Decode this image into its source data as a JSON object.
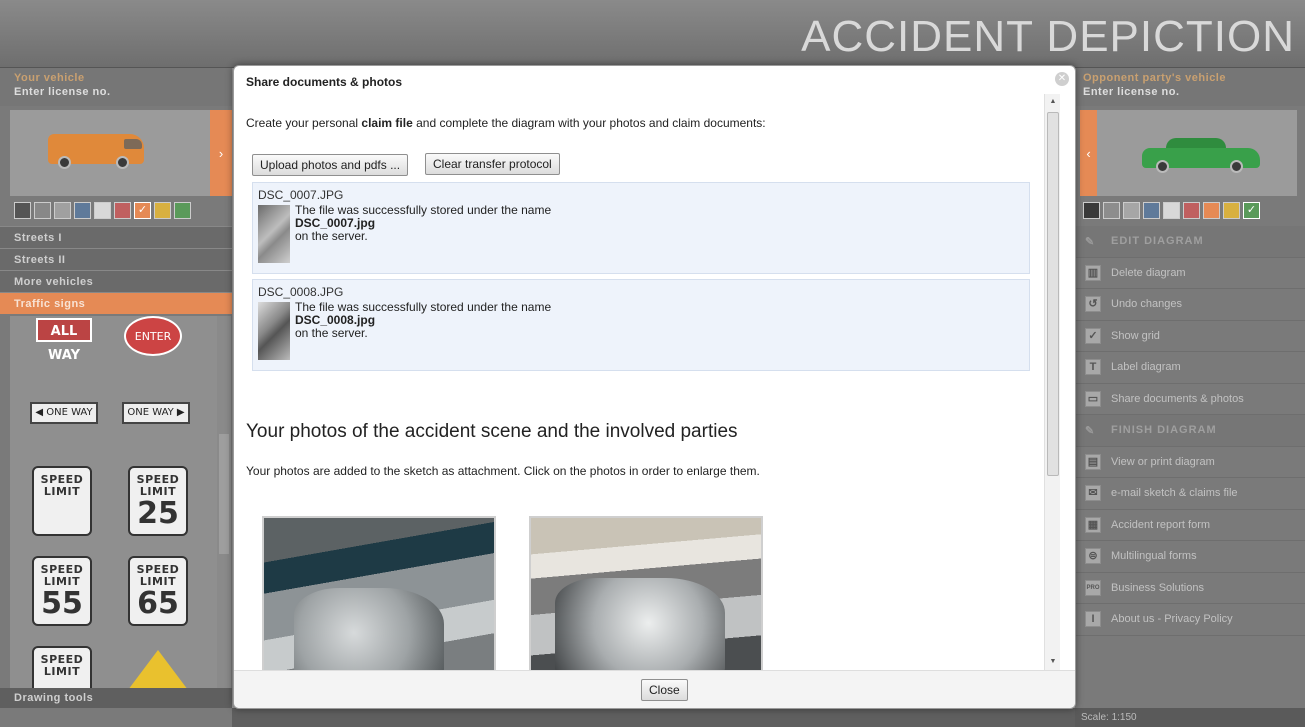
{
  "app": {
    "title": "ACCIDENT  DEPICTION"
  },
  "left_panel": {
    "vehicle_title": "Your vehicle",
    "license_placeholder": "Enter license no.",
    "arrow": "›",
    "colors": [
      "#555555",
      "#888888",
      "#a0a0a0",
      "#5f7a9a",
      "#d8d8d8",
      "#c06060",
      "#e58a55",
      "#d8b040",
      "#5a9a5a"
    ],
    "selected_color_index": 6,
    "menu": [
      {
        "label": "Streets I",
        "active": false
      },
      {
        "label": "Streets II",
        "active": false
      },
      {
        "label": "More vehicles",
        "active": false
      },
      {
        "label": "Traffic signs",
        "active": true
      }
    ],
    "signs": {
      "all_way": "ALL WAY",
      "enter": "ENTER",
      "one_way_left": "◀ ONE WAY",
      "one_way_right": "ONE WAY ▶",
      "speed_label": "SPEED LIMIT",
      "speed_values": [
        "",
        "25",
        "55",
        "65",
        ""
      ]
    },
    "drawing_tools": "Drawing tools"
  },
  "right_panel": {
    "vehicle_title": "Opponent party's vehicle",
    "license_placeholder": "Enter license no.",
    "arrow": "‹",
    "colors": [
      "#3a3a3a",
      "#8d8d8d",
      "#a6a6a6",
      "#5f7a9a",
      "#d8d8d8",
      "#c06060",
      "#e58a55",
      "#d8b040",
      "#5a9a5a"
    ],
    "selected_color_index": 8,
    "edit_section": "EDIT DIAGRAM",
    "edit_items": [
      {
        "label": "Delete diagram",
        "icon": "trash-icon",
        "glyph": "▥"
      },
      {
        "label": "Undo changes",
        "icon": "undo-icon",
        "glyph": "↺"
      },
      {
        "label": "Show grid",
        "icon": "checkbox-icon",
        "glyph": "✓"
      },
      {
        "label": "Label diagram",
        "icon": "text-icon",
        "glyph": "T"
      },
      {
        "label": "Share documents & photos",
        "icon": "folder-icon",
        "glyph": "▭"
      }
    ],
    "finish_section": "FINISH DIAGRAM",
    "finish_items": [
      {
        "label": "View or print diagram",
        "icon": "document-icon",
        "glyph": "▤"
      },
      {
        "label": "e-mail sketch & claims file",
        "icon": "mail-icon",
        "glyph": "✉"
      },
      {
        "label": "Accident report form",
        "icon": "form-icon",
        "glyph": "▦"
      },
      {
        "label": "Multilingual forms",
        "icon": "globe-icon",
        "glyph": "⊜"
      },
      {
        "label": "Business Solutions",
        "icon": "pro-icon",
        "glyph": "PRO"
      },
      {
        "label": "About us - Privacy Policy",
        "icon": "info-icon",
        "glyph": "I"
      }
    ],
    "scale": "Scale: 1:150"
  },
  "dialog": {
    "title": "Share documents & photos",
    "intro_before": "Create your personal ",
    "intro_bold": "claim file",
    "intro_after": " and complete the diagram with your photos and claim documents:",
    "upload_button": "Upload photos and pdfs ...",
    "clear_button": "Clear transfer protocol",
    "files": [
      {
        "name": "DSC_0007.JPG",
        "msg_line1": "The file was successfully stored under the name",
        "stored_name": "DSC_0007.jpg",
        "msg_line2": "on the server."
      },
      {
        "name": "DSC_0008.JPG",
        "msg_line1": "The file was successfully stored under the name",
        "stored_name": "DSC_0008.jpg",
        "msg_line2": "on the server."
      }
    ],
    "photos_heading": "Your photos of the accident scene and the involved parties",
    "photos_text": "Your photos are added to the sketch as attachment. Click on the photos in order to enlarge them.",
    "close_button": "Close"
  }
}
